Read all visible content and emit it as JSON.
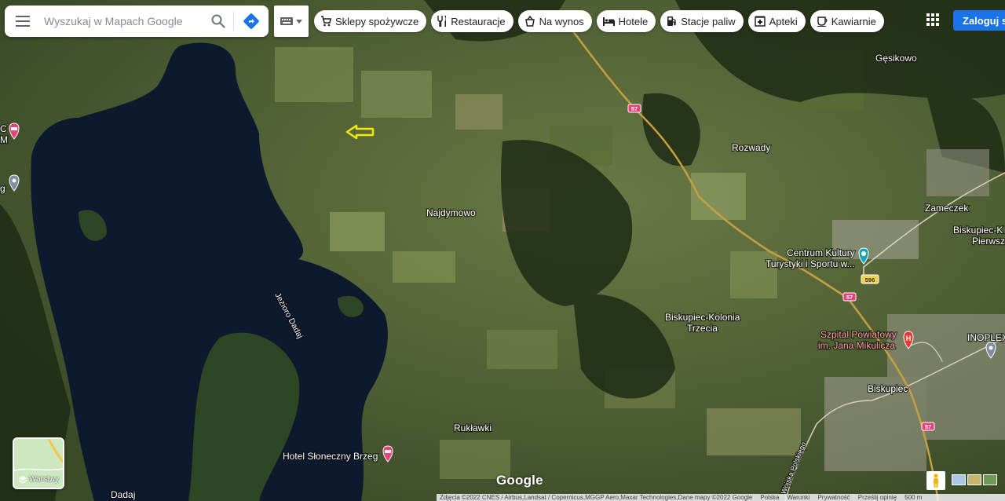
{
  "search": {
    "placeholder": "Wyszukaj w Mapach Google"
  },
  "chips": [
    {
      "label": "Sklepy spożywcze",
      "icon": "cart-icon"
    },
    {
      "label": "Restauracje",
      "icon": "fork-knife-icon"
    },
    {
      "label": "Na wynos",
      "icon": "takeout-icon"
    },
    {
      "label": "Hotele",
      "icon": "bed-icon"
    },
    {
      "label": "Stacje paliw",
      "icon": "gas-pump-icon"
    },
    {
      "label": "Apteki",
      "icon": "pharmacy-icon"
    },
    {
      "label": "Kawiarnie",
      "icon": "coffee-icon"
    }
  ],
  "login_label": "Zaloguj się",
  "layers_label": "Warstwy",
  "google_logo": "Google",
  "place_labels": {
    "gesikowo": "Gęsikowo",
    "rozwady": "Rozwady",
    "najdymowo": "Najdymowo",
    "zameczek": "Zameczek",
    "biskupiec_k1": "Biskupiec-K",
    "biskupiec_k2": "Pierwsz",
    "centrum1": "Centrum Kultury",
    "centrum2": "Turystyki i Sportu w...",
    "kolonia1": "Biskupiec-Kolonia",
    "kolonia2": "Trzecia",
    "szpital1": "Szpital Powiatowy",
    "szpital2": "im. Jana Mikulicza",
    "inoplex": "INOPLEX",
    "biskupiec": "Biskupiec",
    "ruklawki": "Rukławki",
    "hotel": "Hotel Słoneczny Brzeg",
    "dadaj": "Dadaj",
    "jezioro": "Jezioro Dadaj",
    "wojska": "Wojska Polskiego",
    "left_c": "C",
    "left_m": "M",
    "left_g": "g"
  },
  "road_shields": [
    "57",
    "596",
    "57",
    "57"
  ],
  "footer": {
    "attribution": "Zdjęcia ©2022 CNES / Airbus,Landsat / Copernicus,MGGP Aero,Maxar Technologies,Dane mapy ©2022 Google",
    "country": "Polska",
    "terms": "Warunki",
    "privacy": "Prywatność",
    "feedback": "Prześlij opinię",
    "scale": "500 m"
  },
  "colors": {
    "lake": "#0d1a2e",
    "road": "#c6a040",
    "accent": "#1a73e8",
    "marker_pink": "#e8417a",
    "marker_red": "#e53935",
    "marker_teal": "#1aa3b5",
    "arrow": "#f5e70a"
  }
}
